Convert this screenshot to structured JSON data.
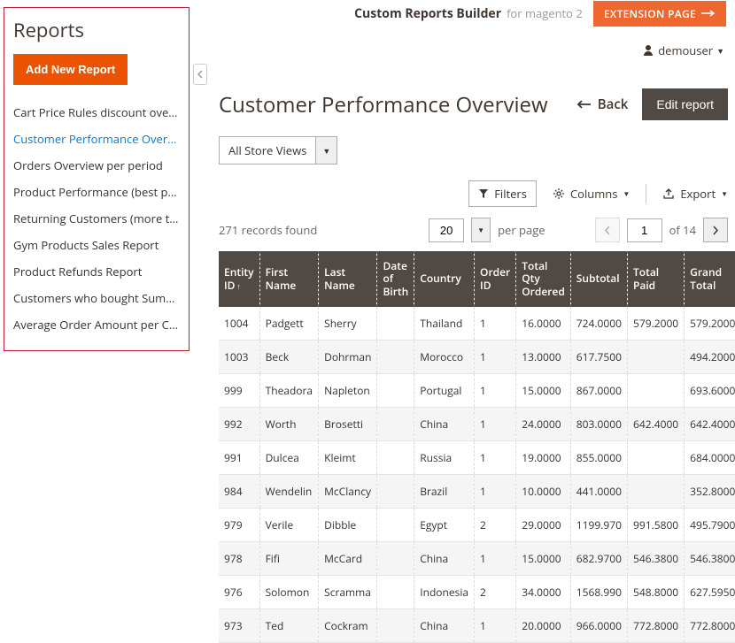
{
  "topbar": {
    "title": "Custom Reports Builder",
    "subtitle": "for magento 2",
    "ext_btn": "EXTENSION PAGE"
  },
  "user": {
    "name": "demouser"
  },
  "sidebar": {
    "heading": "Reports",
    "add_btn": "Add New Report",
    "items": [
      "Cart Price Rules discount overv...",
      "Customer Performance Overvi...",
      "Orders Overview per period",
      "Product Performance (best per...",
      "Returning Customers (more th...",
      "Gym Products Sales Report",
      "Product Refunds Report",
      "Customers who bought Summ...",
      "Average Order Amount per Cu..."
    ],
    "active_index": 1
  },
  "page": {
    "title": "Customer Performance Overview",
    "back": "Back",
    "edit": "Edit report",
    "store_view": "All Store Views"
  },
  "toolbar": {
    "filters": "Filters",
    "columns": "Columns",
    "export": "Export"
  },
  "pager": {
    "records": "271 records found",
    "per_page_value": "20",
    "per_page_label": "per page",
    "page_value": "1",
    "of_label": "of 14"
  },
  "columns": [
    "Entity ID",
    "First Name",
    "Last Name",
    "Date of Birth",
    "Country",
    "Order ID",
    "Total Qty Ordered",
    "Subtotal",
    "Total Paid",
    "Grand Total"
  ],
  "rows": [
    {
      "id": "1004",
      "fn": "Padgett",
      "ln": "Sherry",
      "dob": "",
      "country": "Thailand",
      "oid": "1",
      "qty": "16.0000",
      "sub": "724.0000",
      "paid": "579.2000",
      "gt": "579.2000"
    },
    {
      "id": "1003",
      "fn": "Beck",
      "ln": "Dohrman",
      "dob": "",
      "country": "Morocco",
      "oid": "1",
      "qty": "13.0000",
      "sub": "617.7500",
      "paid": "",
      "gt": "494.2000"
    },
    {
      "id": "999",
      "fn": "Theadora",
      "ln": "Napleton",
      "dob": "",
      "country": "Portugal",
      "oid": "1",
      "qty": "15.0000",
      "sub": "867.0000",
      "paid": "",
      "gt": "693.6000"
    },
    {
      "id": "992",
      "fn": "Worth",
      "ln": "Brosetti",
      "dob": "",
      "country": "China",
      "oid": "1",
      "qty": "24.0000",
      "sub": "803.0000",
      "paid": "642.4000",
      "gt": "642.4000"
    },
    {
      "id": "991",
      "fn": "Dulcea",
      "ln": "Kleimt",
      "dob": "",
      "country": "Russia",
      "oid": "1",
      "qty": "19.0000",
      "sub": "855.0000",
      "paid": "",
      "gt": "684.0000"
    },
    {
      "id": "984",
      "fn": "Wendelin",
      "ln": "McClancy",
      "dob": "",
      "country": "Brazil",
      "oid": "1",
      "qty": "10.0000",
      "sub": "441.0000",
      "paid": "",
      "gt": "352.8000"
    },
    {
      "id": "979",
      "fn": "Verile",
      "ln": "Dibble",
      "dob": "",
      "country": "Egypt",
      "oid": "2",
      "qty": "29.0000",
      "sub": "1199.970",
      "paid": "991.5800",
      "gt": "495.7900"
    },
    {
      "id": "978",
      "fn": "Fifi",
      "ln": "McCard",
      "dob": "",
      "country": "China",
      "oid": "1",
      "qty": "15.0000",
      "sub": "682.9700",
      "paid": "546.3800",
      "gt": "546.3800"
    },
    {
      "id": "976",
      "fn": "Solomon",
      "ln": "Scramma",
      "dob": "",
      "country": "Indonesia",
      "oid": "2",
      "qty": "34.0000",
      "sub": "1568.990",
      "paid": "548.8000",
      "gt": "627.5950"
    },
    {
      "id": "973",
      "fn": "Ted",
      "ln": "Cockram",
      "dob": "",
      "country": "China",
      "oid": "1",
      "qty": "20.0000",
      "sub": "966.0000",
      "paid": "772.8000",
      "gt": "772.8000"
    }
  ]
}
